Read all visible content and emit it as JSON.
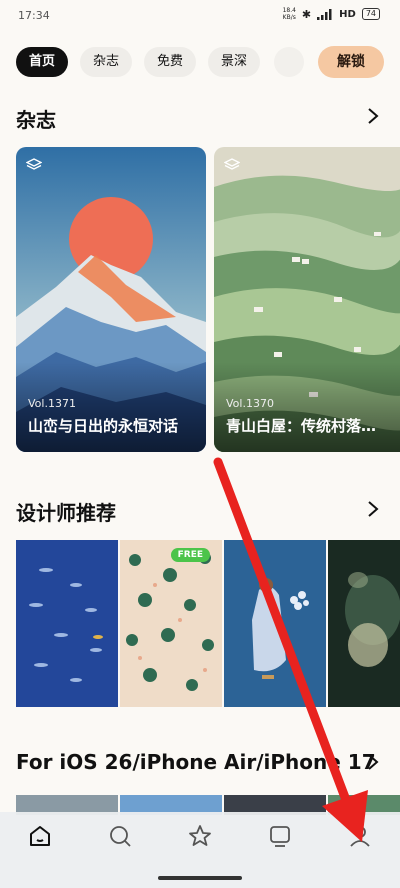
{
  "status_bar": {
    "time": "17:34",
    "net_speed_top": "18.4",
    "net_speed_bottom": "KB/s",
    "network": "HD",
    "battery": "74"
  },
  "tabs": [
    {
      "label": "首页",
      "active": true
    },
    {
      "label": "杂志",
      "active": false
    },
    {
      "label": "免费",
      "active": false
    },
    {
      "label": "景深",
      "active": false
    }
  ],
  "unlock_label": "解锁",
  "sections": {
    "magazine": {
      "title": "杂志",
      "cards": [
        {
          "vol": "Vol.1371",
          "title": "山峦与日出的永恒对话"
        },
        {
          "vol": "Vol.1370",
          "title": "青山白屋：传统村落…"
        }
      ]
    },
    "designer": {
      "title": "设计师推荐",
      "free_badge": "FREE"
    },
    "ios": {
      "title": "For iOS 26/iPhone Air/iPhone 17"
    }
  },
  "bottom_nav": [
    "home-icon",
    "search-icon",
    "star-icon",
    "device-icon",
    "profile-icon"
  ],
  "colors": {
    "unlock_bg": "#f5c8a2",
    "active_tab": "#111111",
    "free_badge": "#4cc44a",
    "annotation_arrow": "#e8231f"
  }
}
